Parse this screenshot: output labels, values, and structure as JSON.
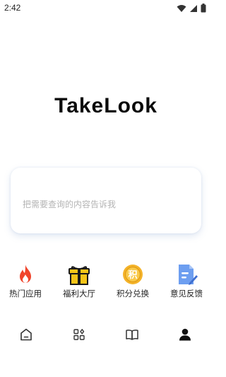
{
  "status_bar": {
    "time": "2:42",
    "icons": [
      "wifi-icon",
      "signal-icon",
      "battery-icon"
    ]
  },
  "app": {
    "title": "TakeLook"
  },
  "search": {
    "placeholder": "把需要查询的内容告诉我",
    "value": ""
  },
  "quick_actions": [
    {
      "label": "热门应用",
      "icon": "flame-icon",
      "color": "#f0442b"
    },
    {
      "label": "福利大厅",
      "icon": "gift-icon",
      "color": "#f5c518"
    },
    {
      "label": "积分兑换",
      "icon": "points-coin-icon",
      "icon_text": "积",
      "color": "#f4b32a"
    },
    {
      "label": "意见反馈",
      "icon": "feedback-doc-icon",
      "color": "#6d9ef0"
    }
  ],
  "bottom_nav": [
    {
      "name": "nav-home",
      "icon": "home-icon"
    },
    {
      "name": "nav-apps",
      "icon": "apps-grid-icon"
    },
    {
      "name": "nav-reading",
      "icon": "book-icon"
    },
    {
      "name": "nav-profile",
      "icon": "person-icon",
      "active": true
    }
  ],
  "colors": {
    "accent_search_shadow": "#7896c8",
    "nav_icon": "#333333"
  }
}
